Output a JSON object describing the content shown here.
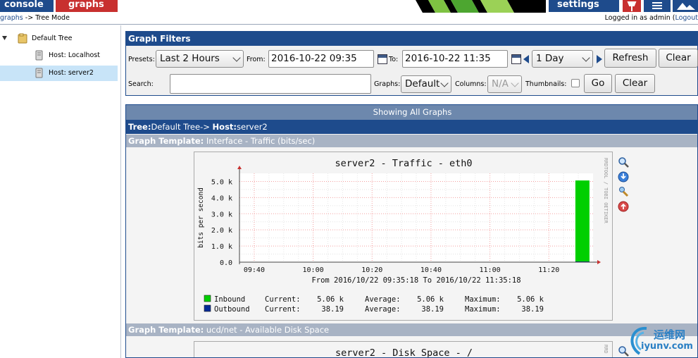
{
  "topbar": {
    "tabs": [
      {
        "label": "console"
      },
      {
        "label": "graphs"
      },
      {
        "label": "settings"
      }
    ]
  },
  "breadcrumb": {
    "parent": "graphs",
    "separator": "->",
    "current": "Tree Mode"
  },
  "login": {
    "prefix": "Logged in as admin (",
    "link": "Logout"
  },
  "tree": {
    "root": "Default Tree",
    "hosts": [
      "Host: Localhost",
      "Host: server2"
    ]
  },
  "filters": {
    "title": "Graph Filters",
    "presets_label": "Presets:",
    "presets_value": "Last 2 Hours",
    "from_label": "From:",
    "from_value": "2016-10-22 09:35",
    "to_label": "To:",
    "to_value": "2016-10-22 11:35",
    "span_value": "1 Day",
    "refresh_label": "Refresh",
    "clear_label": "Clear",
    "search_label": "Search:",
    "search_value": "",
    "graphs_label": "Graphs:",
    "graphs_value": "Default",
    "columns_label": "Columns:",
    "columns_value": "N/A",
    "thumbnails_label": "Thumbnails:",
    "go_label": "Go",
    "clear2_label": "Clear"
  },
  "content": {
    "showing": "Showing All Graphs",
    "tree_label": "Tree:",
    "tree_value": "Default Tree",
    "host_arrow": "->",
    "host_label": "Host:",
    "host_value": "server2",
    "template_label": "Graph Template:",
    "template1": "Interface - Traffic (bits/sec)",
    "template2": "ucd/net - Available Disk Space"
  },
  "graph1": {
    "title": "server2 - Traffic - eth0",
    "side_text": "RRDTOOL / TOBI OETIKER",
    "range_text": "From 2016/10/22 09:35:18 To 2016/10/22 11:35:18",
    "legend": [
      {
        "name": "Inbound",
        "current_label": "Current:",
        "current": "5.06 k",
        "average_label": "Average:",
        "average": "5.06 k",
        "maximum_label": "Maximum:",
        "maximum": "5.06 k",
        "color": "#00cf00"
      },
      {
        "name": "Outbound",
        "current_label": "Current:",
        "current": "38.19",
        "average_label": "Average:",
        "average": "38.19",
        "maximum_label": "Maximum:",
        "maximum": "38.19",
        "color": "#002a97"
      }
    ]
  },
  "graph2": {
    "title": "server2 - Disk Space - /",
    "side_text": "RRD"
  },
  "chart_data": {
    "type": "bar",
    "title": "server2 - Traffic - eth0",
    "ylabel": "bits per second",
    "xlabel": "",
    "x_ticks": [
      "09:40",
      "10:00",
      "10:20",
      "10:40",
      "11:00",
      "11:20"
    ],
    "y_ticks": [
      "0.0",
      "1.0 k",
      "2.0 k",
      "3.0 k",
      "4.0 k",
      "5.0 k"
    ],
    "ylim": [
      0,
      5500
    ],
    "x_range": [
      "09:35",
      "11:35"
    ],
    "grid": true,
    "series": [
      {
        "name": "Inbound",
        "color": "#00cf00",
        "points": [
          {
            "x": "11:29",
            "y": 5060
          }
        ]
      },
      {
        "name": "Outbound",
        "color": "#002a97",
        "points": [
          {
            "x": "11:29",
            "y": 38.19
          }
        ]
      }
    ]
  },
  "watermark": {
    "cn": "运维网",
    "url": "iyunv.com"
  }
}
